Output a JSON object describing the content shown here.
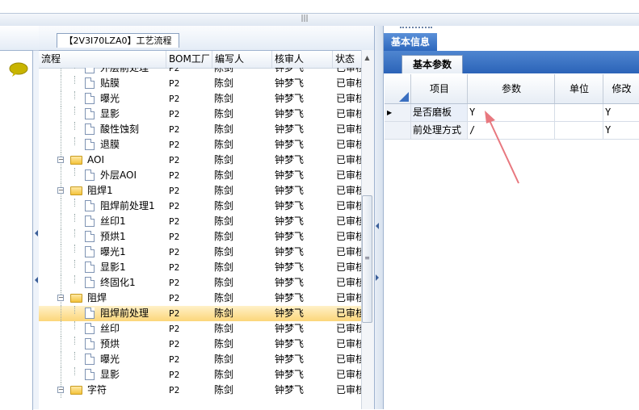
{
  "top_splitter": {
    "grip": "|||"
  },
  "left_panel": {
    "chat_icon": "speech-bubble-icon"
  },
  "center": {
    "tab_title": "【2V3I70LZA0】工艺流程",
    "columns": [
      "流程",
      "BOM工厂",
      "编写人",
      "核审人",
      "状态"
    ],
    "rows": [
      {
        "name": "外层前处理",
        "type": "doc",
        "level": 2,
        "bom": "P2",
        "writer": "陈剑",
        "reviewer": "钟梦飞",
        "status": "已审核"
      },
      {
        "name": "贴膜",
        "type": "doc",
        "level": 2,
        "bom": "P2",
        "writer": "陈剑",
        "reviewer": "钟梦飞",
        "status": "已审核"
      },
      {
        "name": "曝光",
        "type": "doc",
        "level": 2,
        "bom": "P2",
        "writer": "陈剑",
        "reviewer": "钟梦飞",
        "status": "已审核"
      },
      {
        "name": "显影",
        "type": "doc",
        "level": 2,
        "bom": "P2",
        "writer": "陈剑",
        "reviewer": "钟梦飞",
        "status": "已审核"
      },
      {
        "name": "酸性蚀刻",
        "type": "doc",
        "level": 2,
        "bom": "P2",
        "writer": "陈剑",
        "reviewer": "钟梦飞",
        "status": "已审核"
      },
      {
        "name": "退膜",
        "type": "doc",
        "level": 2,
        "bom": "P2",
        "writer": "陈剑",
        "reviewer": "钟梦飞",
        "status": "已审核"
      },
      {
        "name": "AOI",
        "type": "folder",
        "level": 1,
        "bom": "P2",
        "writer": "陈剑",
        "reviewer": "钟梦飞",
        "status": "已审核"
      },
      {
        "name": "外层AOI",
        "type": "doc",
        "level": 2,
        "bom": "P2",
        "writer": "陈剑",
        "reviewer": "钟梦飞",
        "status": "已审核"
      },
      {
        "name": "阻焊1",
        "type": "folder",
        "level": 1,
        "bom": "P2",
        "writer": "陈剑",
        "reviewer": "钟梦飞",
        "status": "已审核"
      },
      {
        "name": "阻焊前处理1",
        "type": "doc",
        "level": 2,
        "bom": "P2",
        "writer": "陈剑",
        "reviewer": "钟梦飞",
        "status": "已审核"
      },
      {
        "name": "丝印1",
        "type": "doc",
        "level": 2,
        "bom": "P2",
        "writer": "陈剑",
        "reviewer": "钟梦飞",
        "status": "已审核"
      },
      {
        "name": "预烘1",
        "type": "doc",
        "level": 2,
        "bom": "P2",
        "writer": "陈剑",
        "reviewer": "钟梦飞",
        "status": "已审核"
      },
      {
        "name": "曝光1",
        "type": "doc",
        "level": 2,
        "bom": "P2",
        "writer": "陈剑",
        "reviewer": "钟梦飞",
        "status": "已审核"
      },
      {
        "name": "显影1",
        "type": "doc",
        "level": 2,
        "bom": "P2",
        "writer": "陈剑",
        "reviewer": "钟梦飞",
        "status": "已审核"
      },
      {
        "name": "终固化1",
        "type": "doc",
        "level": 2,
        "bom": "P2",
        "writer": "陈剑",
        "reviewer": "钟梦飞",
        "status": "已审核"
      },
      {
        "name": "阻焊",
        "type": "folder",
        "level": 1,
        "bom": "P2",
        "writer": "陈剑",
        "reviewer": "钟梦飞",
        "status": "已审核"
      },
      {
        "name": "阻焊前处理",
        "type": "doc",
        "level": 2,
        "bom": "P2",
        "writer": "陈剑",
        "reviewer": "钟梦飞",
        "status": "已审核",
        "selected": true
      },
      {
        "name": "丝印",
        "type": "doc",
        "level": 2,
        "bom": "P2",
        "writer": "陈剑",
        "reviewer": "钟梦飞",
        "status": "已审核"
      },
      {
        "name": "预烘",
        "type": "doc",
        "level": 2,
        "bom": "P2",
        "writer": "陈剑",
        "reviewer": "钟梦飞",
        "status": "已审核"
      },
      {
        "name": "曝光",
        "type": "doc",
        "level": 2,
        "bom": "P2",
        "writer": "陈剑",
        "reviewer": "钟梦飞",
        "status": "已审核"
      },
      {
        "name": "显影",
        "type": "doc",
        "level": 2,
        "bom": "P2",
        "writer": "陈剑",
        "reviewer": "钟梦飞",
        "status": "已审核"
      },
      {
        "name": "字符",
        "type": "folder",
        "level": 1,
        "bom": "P2",
        "writer": "陈剑",
        "reviewer": "钟梦飞",
        "status": "已审核"
      }
    ]
  },
  "right": {
    "tab_main": "基本信息",
    "tab_sub": "基本参数",
    "columns": [
      "项目",
      "参数",
      "单位",
      "修改"
    ],
    "rows": [
      {
        "item": "是否磨板",
        "param": "Y",
        "unit": "",
        "modify": "Y",
        "current": true
      },
      {
        "item": "前处理方式",
        "param": "/",
        "unit": "",
        "modify": "Y",
        "current": false
      }
    ],
    "annotation_color": "#e8787f"
  }
}
